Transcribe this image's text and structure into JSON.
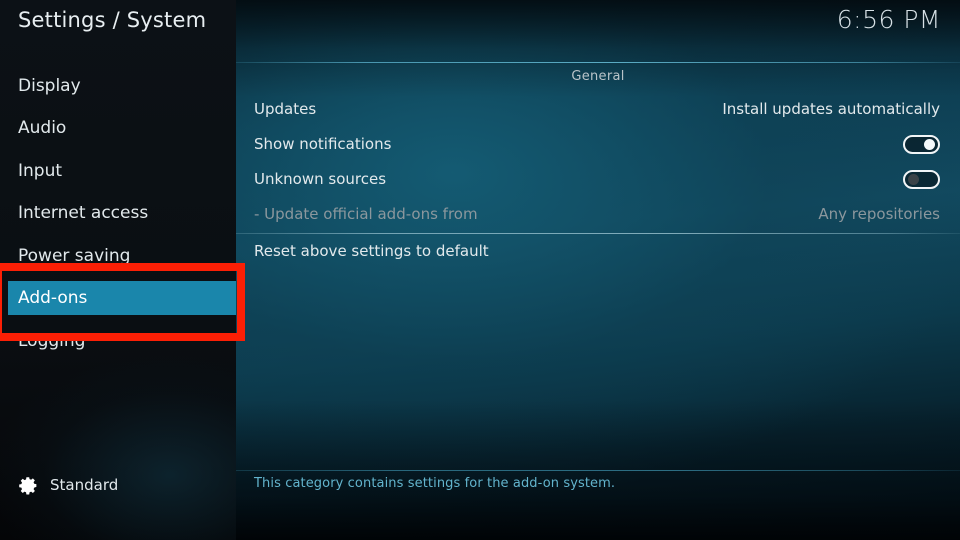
{
  "header": {
    "title": "Settings / System",
    "clock": "6:56 PM"
  },
  "sidebar": {
    "items": [
      {
        "label": "Display",
        "selected": false
      },
      {
        "label": "Audio",
        "selected": false
      },
      {
        "label": "Input",
        "selected": false
      },
      {
        "label": "Internet access",
        "selected": false
      },
      {
        "label": "Power saving",
        "selected": false
      },
      {
        "label": "Add-ons",
        "selected": true
      },
      {
        "label": "Logging",
        "selected": false
      }
    ],
    "profile": {
      "icon": "gear-icon",
      "label": "Standard"
    }
  },
  "main": {
    "section_title": "General",
    "rows": [
      {
        "label": "Updates",
        "control": "value",
        "value": "Install updates automatically",
        "dim": false
      },
      {
        "label": "Show notifications",
        "control": "toggle",
        "toggle_state": "on",
        "dim": false
      },
      {
        "label": "Unknown sources",
        "control": "toggle",
        "toggle_state": "off",
        "dim": false
      },
      {
        "label": "- Update official add-ons from",
        "control": "value",
        "value": "Any repositories",
        "dim": true
      },
      {
        "label": "Reset above settings to default",
        "control": "none",
        "value": "",
        "dim": false
      }
    ],
    "help_text": "This category contains settings for the add-on system."
  },
  "annotation": {
    "type": "highlight-box",
    "color": "#fb1f05",
    "targets": "Add-ons"
  },
  "colors": {
    "accent": "#1a86ab",
    "annotation": "#fb1f05",
    "help_text": "#63b4cd",
    "separator": "#6ec8e2"
  }
}
